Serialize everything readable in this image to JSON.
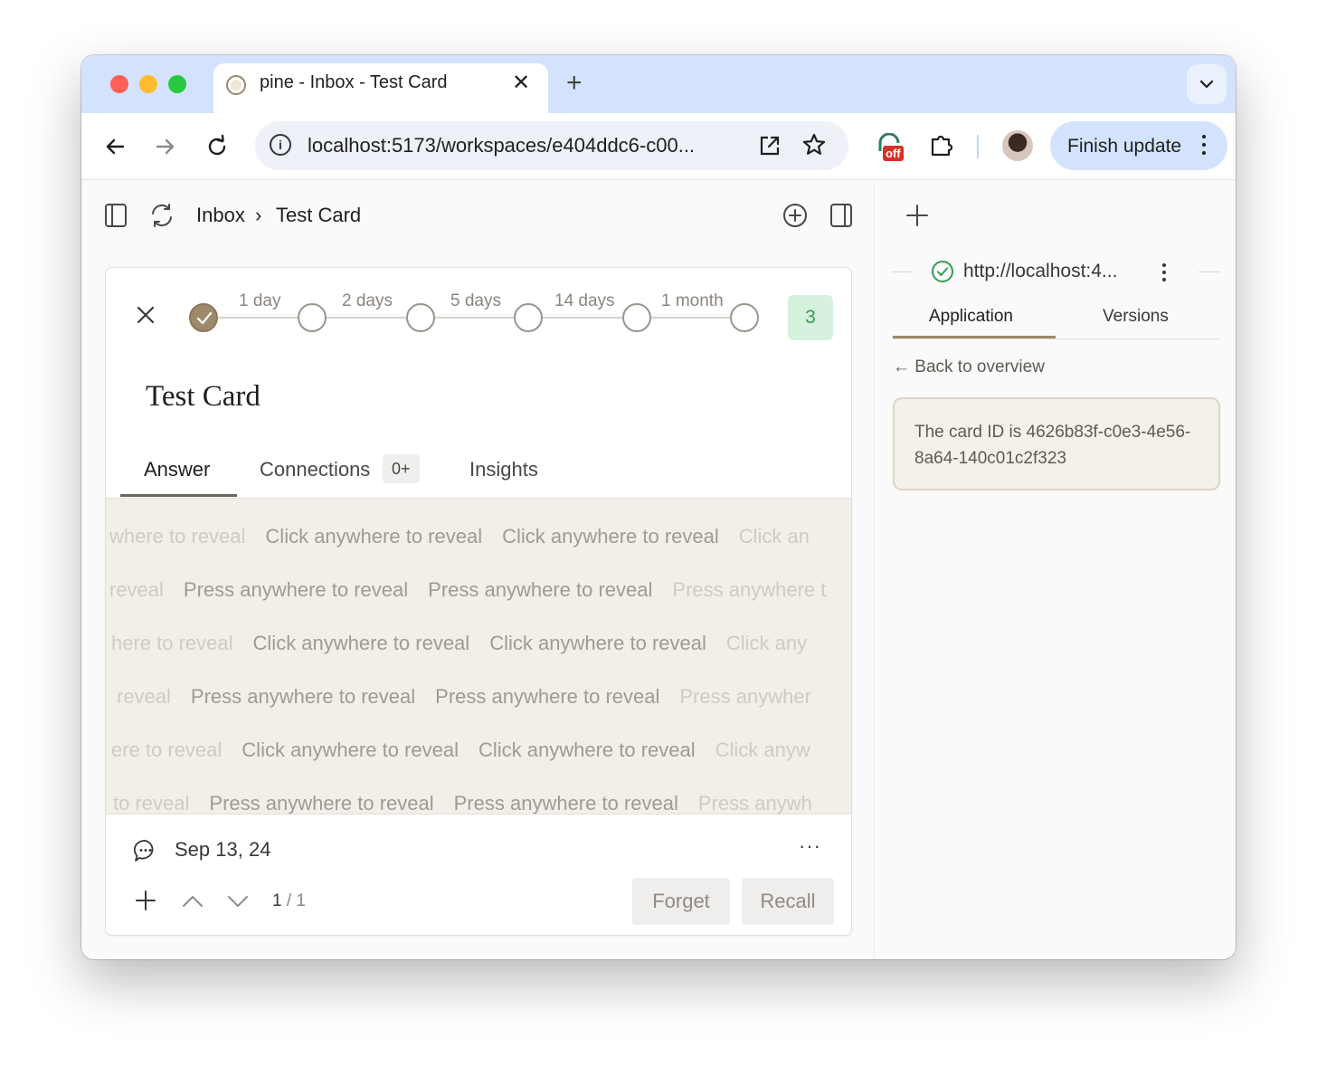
{
  "browser": {
    "tab_title": "pine - Inbox - Test Card",
    "tab_close": "✕",
    "new_tab": "+",
    "url": "localhost:5173/workspaces/e404ddc6-c00...",
    "extension_badge": "off",
    "finish_update_label": "Finish update"
  },
  "header": {
    "breadcrumb_root": "Inbox",
    "breadcrumb_sep": "›",
    "breadcrumb_current": "Test Card"
  },
  "card": {
    "intervals": [
      "1 day",
      "2 days",
      "5 days",
      "14 days",
      "1 month"
    ],
    "completed_steps": 1,
    "count": "3",
    "title": "Test Card",
    "tabs": {
      "answer": "Answer",
      "connections": "Connections",
      "connections_badge": "0+",
      "insights": "Insights"
    },
    "reveal_rows": [
      [
        "where to reveal",
        "Click anywhere to reveal",
        "Click anywhere to reveal",
        "Click an"
      ],
      [
        "reveal",
        "Press anywhere to reveal",
        "Press anywhere to reveal",
        "Press anywhere t"
      ],
      [
        "here to reveal",
        "Click anywhere to reveal",
        "Click anywhere to reveal",
        "Click any"
      ],
      [
        "reveal",
        "Press anywhere to reveal",
        "Press anywhere to reveal",
        "Press anywher"
      ],
      [
        "ere to reveal",
        "Click anywhere to reveal",
        "Click anywhere to reveal",
        "Click anyw"
      ],
      [
        "to reveal",
        "Press anywhere to reveal",
        "Press anywhere to reveal",
        "Press anywh"
      ]
    ],
    "footer": {
      "date": "Sep 13, 24",
      "more": "···",
      "page_current": "1",
      "page_sep": " / ",
      "page_total": "1",
      "forget_label": "Forget",
      "recall_label": "Recall"
    }
  },
  "right_pane": {
    "site_url": "http://localhost:4...",
    "tabs": {
      "application": "Application",
      "versions": "Versions"
    },
    "back_label": "← Back to overview",
    "note": "The card ID is 4626b83f-c0e3-4e56-8a64-140c01c2f323"
  },
  "colors": {
    "tabstrip": "#d3e3fd",
    "accent_brown": "#9c8a6a",
    "count_badge_bg": "#d6f1de",
    "count_badge_fg": "#2f9e55",
    "reveal_bg": "#f2efe8",
    "note_bg": "#f4f1e8"
  }
}
